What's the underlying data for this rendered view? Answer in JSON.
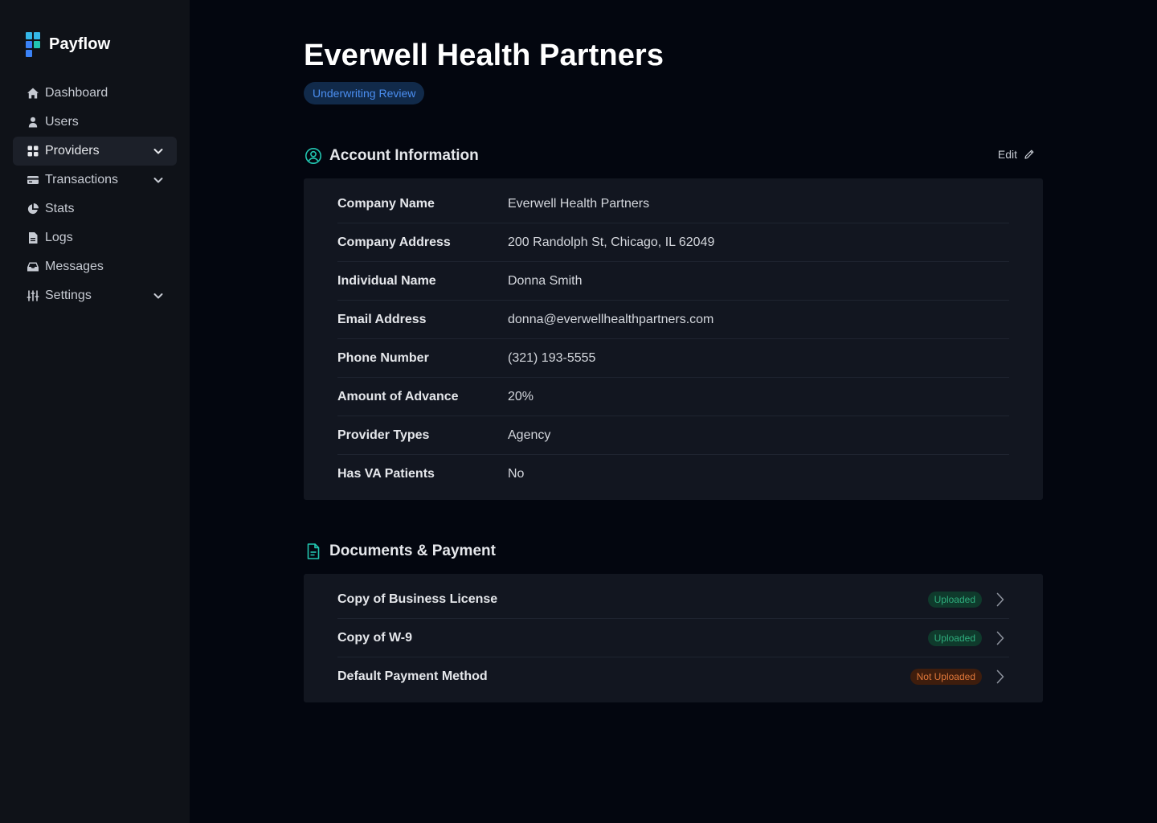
{
  "app": {
    "name": "Payflow",
    "logo_colors": [
      "#34b7e8",
      "#3b82f6",
      "#22c5b0"
    ]
  },
  "sidebar": {
    "items": [
      {
        "label": "Dashboard",
        "icon": "home-icon",
        "active": false,
        "expandable": false
      },
      {
        "label": "Users",
        "icon": "user-icon",
        "active": false,
        "expandable": false
      },
      {
        "label": "Providers",
        "icon": "grid-icon",
        "active": true,
        "expandable": true
      },
      {
        "label": "Transactions",
        "icon": "credit-card-icon",
        "active": false,
        "expandable": true
      },
      {
        "label": "Stats",
        "icon": "pie-chart-icon",
        "active": false,
        "expandable": false
      },
      {
        "label": "Logs",
        "icon": "document-icon",
        "active": false,
        "expandable": false
      },
      {
        "label": "Messages",
        "icon": "inbox-icon",
        "active": false,
        "expandable": false
      },
      {
        "label": "Settings",
        "icon": "sliders-icon",
        "active": false,
        "expandable": true
      }
    ]
  },
  "page": {
    "title": "Everwell Health Partners",
    "status": "Underwriting Review"
  },
  "account": {
    "title": "Account Information",
    "icon": "user-circle-icon",
    "edit_label": "Edit",
    "rows": [
      {
        "label": "Company Name",
        "value": "Everwell Health Partners"
      },
      {
        "label": "Company Address",
        "value": "200 Randolph St, Chicago, IL 62049"
      },
      {
        "label": "Individual Name",
        "value": "Donna Smith"
      },
      {
        "label": "Email Address",
        "value": "donna@everwellhealthpartners.com"
      },
      {
        "label": "Phone Number",
        "value": "(321) 193-5555"
      },
      {
        "label": "Amount of Advance",
        "value": "20%"
      },
      {
        "label": "Provider Types",
        "value": "Agency"
      },
      {
        "label": "Has VA Patients",
        "value": "No"
      }
    ]
  },
  "documents": {
    "title": "Documents & Payment",
    "icon": "document-icon",
    "rows": [
      {
        "label": "Copy of Business License",
        "status": "Uploaded",
        "state": "ok"
      },
      {
        "label": "Copy of W-9",
        "status": "Uploaded",
        "state": "ok"
      },
      {
        "label": "Default Payment Method",
        "status": "Not Uploaded",
        "state": "warn"
      }
    ]
  },
  "colors": {
    "accent": "#22c5b0",
    "status_blue": "#4b8ef0",
    "uploaded": "#2fae7e",
    "not_uploaded": "#e0783a"
  }
}
